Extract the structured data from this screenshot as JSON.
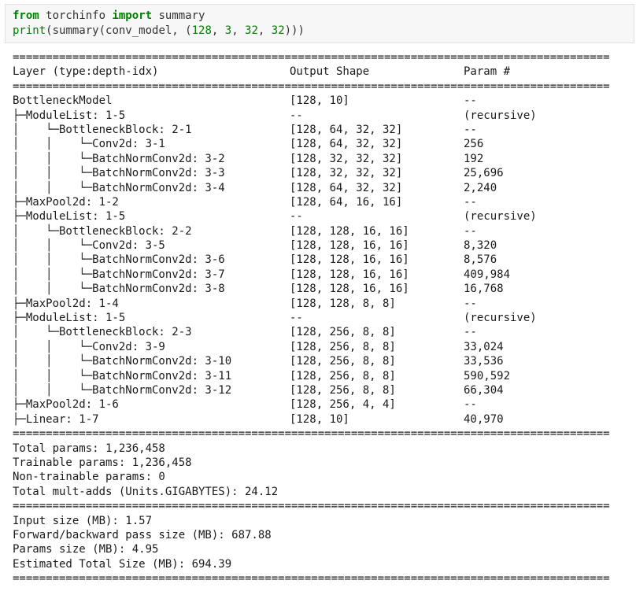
{
  "code": {
    "line1": [
      {
        "t": "from",
        "c": "kw"
      },
      {
        "t": " torchinfo ",
        "c": "pn"
      },
      {
        "t": "import",
        "c": "kw"
      },
      {
        "t": " summary",
        "c": "pn"
      }
    ],
    "line2": [
      {
        "t": "print",
        "c": "bi"
      },
      {
        "t": "(summary(conv_model, (",
        "c": "pn"
      },
      {
        "t": "128",
        "c": "num"
      },
      {
        "t": ", ",
        "c": "pn"
      },
      {
        "t": "3",
        "c": "num"
      },
      {
        "t": ", ",
        "c": "pn"
      },
      {
        "t": "32",
        "c": "num"
      },
      {
        "t": ", ",
        "c": "pn"
      },
      {
        "t": "32",
        "c": "num"
      },
      {
        "t": ")))",
        "c": "pn"
      }
    ]
  },
  "separator": "==========================================================================================",
  "header": {
    "layer": "Layer (type:depth-idx)",
    "shape": "Output Shape",
    "params": "Param #"
  },
  "layers": [
    {
      "name": "BottleneckModel",
      "shape": "[128, 10]",
      "params": "--"
    },
    {
      "name": "├─ModuleList: 1-5",
      "shape": "--",
      "params": "(recursive)"
    },
    {
      "name": "│    └─BottleneckBlock: 2-1",
      "shape": "[128, 64, 32, 32]",
      "params": "--"
    },
    {
      "name": "│    │    └─Conv2d: 3-1",
      "shape": "[128, 64, 32, 32]",
      "params": "256"
    },
    {
      "name": "│    │    └─BatchNormConv2d: 3-2",
      "shape": "[128, 32, 32, 32]",
      "params": "192"
    },
    {
      "name": "│    │    └─BatchNormConv2d: 3-3",
      "shape": "[128, 32, 32, 32]",
      "params": "25,696"
    },
    {
      "name": "│    │    └─BatchNormConv2d: 3-4",
      "shape": "[128, 64, 32, 32]",
      "params": "2,240"
    },
    {
      "name": "├─MaxPool2d: 1-2",
      "shape": "[128, 64, 16, 16]",
      "params": "--"
    },
    {
      "name": "├─ModuleList: 1-5",
      "shape": "--",
      "params": "(recursive)"
    },
    {
      "name": "│    └─BottleneckBlock: 2-2",
      "shape": "[128, 128, 16, 16]",
      "params": "--"
    },
    {
      "name": "│    │    └─Conv2d: 3-5",
      "shape": "[128, 128, 16, 16]",
      "params": "8,320"
    },
    {
      "name": "│    │    └─BatchNormConv2d: 3-6",
      "shape": "[128, 128, 16, 16]",
      "params": "8,576"
    },
    {
      "name": "│    │    └─BatchNormConv2d: 3-7",
      "shape": "[128, 128, 16, 16]",
      "params": "409,984"
    },
    {
      "name": "│    │    └─BatchNormConv2d: 3-8",
      "shape": "[128, 128, 16, 16]",
      "params": "16,768"
    },
    {
      "name": "├─MaxPool2d: 1-4",
      "shape": "[128, 128, 8, 8]",
      "params": "--"
    },
    {
      "name": "├─ModuleList: 1-5",
      "shape": "--",
      "params": "(recursive)"
    },
    {
      "name": "│    └─BottleneckBlock: 2-3",
      "shape": "[128, 256, 8, 8]",
      "params": "--"
    },
    {
      "name": "│    │    └─Conv2d: 3-9",
      "shape": "[128, 256, 8, 8]",
      "params": "33,024"
    },
    {
      "name": "│    │    └─BatchNormConv2d: 3-10",
      "shape": "[128, 256, 8, 8]",
      "params": "33,536"
    },
    {
      "name": "│    │    └─BatchNormConv2d: 3-11",
      "shape": "[128, 256, 8, 8]",
      "params": "590,592"
    },
    {
      "name": "│    │    └─BatchNormConv2d: 3-12",
      "shape": "[128, 256, 8, 8]",
      "params": "66,304"
    },
    {
      "name": "├─MaxPool2d: 1-6",
      "shape": "[128, 256, 4, 4]",
      "params": "--"
    },
    {
      "name": "├─Linear: 1-7",
      "shape": "[128, 10]",
      "params": "40,970"
    }
  ],
  "param_totals": {
    "total": "Total params: 1,236,458",
    "trainable": "Trainable params: 1,236,458",
    "non_trainable": "Non-trainable params: 0",
    "mult_adds": "Total mult-adds (Units.GIGABYTES): 24.12"
  },
  "sizes": {
    "input": "Input size (MB): 1.57",
    "forward_backward": "Forward/backward pass size (MB): 687.88",
    "params": "Params size (MB): 4.95",
    "total": "Estimated Total Size (MB): 694.39"
  }
}
